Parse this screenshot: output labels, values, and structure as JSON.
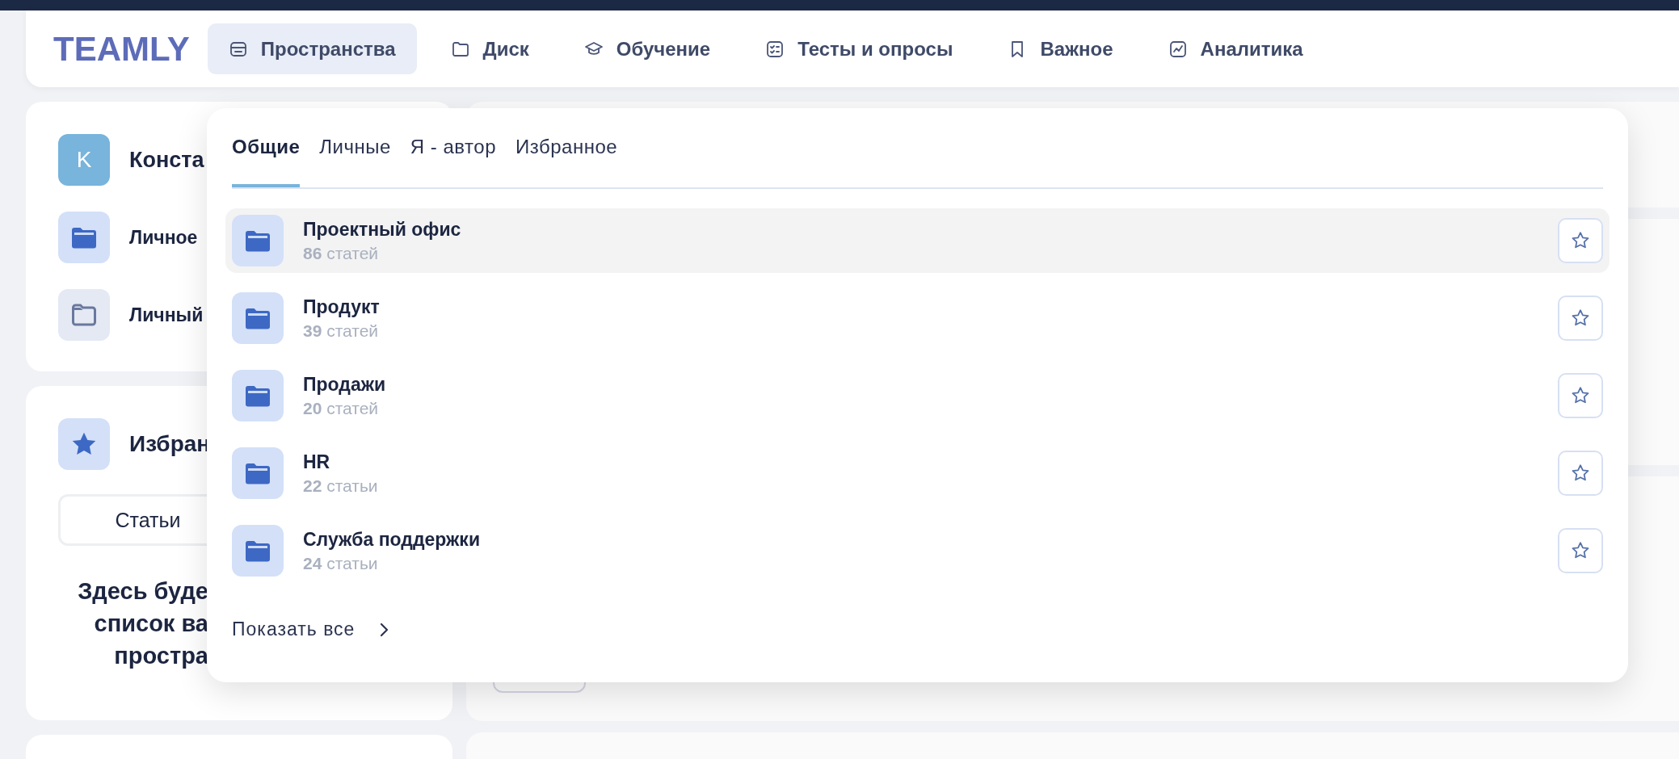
{
  "logo": "TEAMLY",
  "nav": [
    {
      "label": "Пространства",
      "kind": "spaces",
      "selected": true
    },
    {
      "label": "Диск",
      "kind": "folder",
      "selected": false
    },
    {
      "label": "Обучение",
      "kind": "cap",
      "selected": false
    },
    {
      "label": "Тесты и опросы",
      "kind": "checklist",
      "selected": false
    },
    {
      "label": "Важное",
      "kind": "bookmark",
      "selected": false
    },
    {
      "label": "Аналитика",
      "kind": "chart",
      "selected": false
    }
  ],
  "profile": {
    "initial": "K",
    "name": "Конста"
  },
  "personal_items": [
    {
      "label": "Личное",
      "kind": "filled"
    },
    {
      "label": "Личный",
      "kind": "outline"
    }
  ],
  "favorites": {
    "title": "Избран",
    "tab": "Статьи",
    "empty_text": "Здесь буде\nсписок ва\nпростра"
  },
  "dropdown": {
    "tabs": [
      {
        "label": "Общие",
        "selected": true
      },
      {
        "label": "Личные",
        "selected": false
      },
      {
        "label": "Я - автор",
        "selected": false
      },
      {
        "label": "Избранное",
        "selected": false
      }
    ],
    "spaces": [
      {
        "name": "Проектный офис",
        "count": "**86** статей",
        "selected": true,
        "starred": false
      },
      {
        "name": "Продукт",
        "count": "**39** статей",
        "selected": false,
        "starred": false
      },
      {
        "name": "Продажи",
        "count": "**20** статей",
        "selected": false,
        "starred": false
      },
      {
        "name": "HR",
        "count": "**22** статьи",
        "selected": false,
        "starred": false
      },
      {
        "name": "Служба поддержки",
        "count": "**24** статьи",
        "selected": false,
        "starred": false
      }
    ],
    "show_all": "Показать все"
  }
}
